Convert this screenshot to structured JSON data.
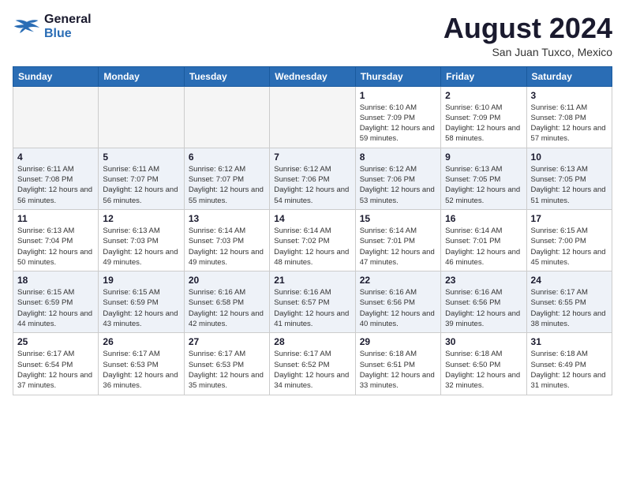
{
  "header": {
    "logo_line1": "General",
    "logo_line2": "Blue",
    "month_year": "August 2024",
    "location": "San Juan Tuxco, Mexico"
  },
  "weekdays": [
    "Sunday",
    "Monday",
    "Tuesday",
    "Wednesday",
    "Thursday",
    "Friday",
    "Saturday"
  ],
  "weeks": [
    [
      {
        "day": "",
        "empty": true
      },
      {
        "day": "",
        "empty": true
      },
      {
        "day": "",
        "empty": true
      },
      {
        "day": "",
        "empty": true
      },
      {
        "day": "1",
        "sunrise": "6:10 AM",
        "sunset": "7:09 PM",
        "daylight": "12 hours and 59 minutes."
      },
      {
        "day": "2",
        "sunrise": "6:10 AM",
        "sunset": "7:09 PM",
        "daylight": "12 hours and 58 minutes."
      },
      {
        "day": "3",
        "sunrise": "6:11 AM",
        "sunset": "7:08 PM",
        "daylight": "12 hours and 57 minutes."
      }
    ],
    [
      {
        "day": "4",
        "sunrise": "6:11 AM",
        "sunset": "7:08 PM",
        "daylight": "12 hours and 56 minutes."
      },
      {
        "day": "5",
        "sunrise": "6:11 AM",
        "sunset": "7:07 PM",
        "daylight": "12 hours and 56 minutes."
      },
      {
        "day": "6",
        "sunrise": "6:12 AM",
        "sunset": "7:07 PM",
        "daylight": "12 hours and 55 minutes."
      },
      {
        "day": "7",
        "sunrise": "6:12 AM",
        "sunset": "7:06 PM",
        "daylight": "12 hours and 54 minutes."
      },
      {
        "day": "8",
        "sunrise": "6:12 AM",
        "sunset": "7:06 PM",
        "daylight": "12 hours and 53 minutes."
      },
      {
        "day": "9",
        "sunrise": "6:13 AM",
        "sunset": "7:05 PM",
        "daylight": "12 hours and 52 minutes."
      },
      {
        "day": "10",
        "sunrise": "6:13 AM",
        "sunset": "7:05 PM",
        "daylight": "12 hours and 51 minutes."
      }
    ],
    [
      {
        "day": "11",
        "sunrise": "6:13 AM",
        "sunset": "7:04 PM",
        "daylight": "12 hours and 50 minutes."
      },
      {
        "day": "12",
        "sunrise": "6:13 AM",
        "sunset": "7:03 PM",
        "daylight": "12 hours and 49 minutes."
      },
      {
        "day": "13",
        "sunrise": "6:14 AM",
        "sunset": "7:03 PM",
        "daylight": "12 hours and 49 minutes."
      },
      {
        "day": "14",
        "sunrise": "6:14 AM",
        "sunset": "7:02 PM",
        "daylight": "12 hours and 48 minutes."
      },
      {
        "day": "15",
        "sunrise": "6:14 AM",
        "sunset": "7:01 PM",
        "daylight": "12 hours and 47 minutes."
      },
      {
        "day": "16",
        "sunrise": "6:14 AM",
        "sunset": "7:01 PM",
        "daylight": "12 hours and 46 minutes."
      },
      {
        "day": "17",
        "sunrise": "6:15 AM",
        "sunset": "7:00 PM",
        "daylight": "12 hours and 45 minutes."
      }
    ],
    [
      {
        "day": "18",
        "sunrise": "6:15 AM",
        "sunset": "6:59 PM",
        "daylight": "12 hours and 44 minutes."
      },
      {
        "day": "19",
        "sunrise": "6:15 AM",
        "sunset": "6:59 PM",
        "daylight": "12 hours and 43 minutes."
      },
      {
        "day": "20",
        "sunrise": "6:16 AM",
        "sunset": "6:58 PM",
        "daylight": "12 hours and 42 minutes."
      },
      {
        "day": "21",
        "sunrise": "6:16 AM",
        "sunset": "6:57 PM",
        "daylight": "12 hours and 41 minutes."
      },
      {
        "day": "22",
        "sunrise": "6:16 AM",
        "sunset": "6:56 PM",
        "daylight": "12 hours and 40 minutes."
      },
      {
        "day": "23",
        "sunrise": "6:16 AM",
        "sunset": "6:56 PM",
        "daylight": "12 hours and 39 minutes."
      },
      {
        "day": "24",
        "sunrise": "6:17 AM",
        "sunset": "6:55 PM",
        "daylight": "12 hours and 38 minutes."
      }
    ],
    [
      {
        "day": "25",
        "sunrise": "6:17 AM",
        "sunset": "6:54 PM",
        "daylight": "12 hours and 37 minutes."
      },
      {
        "day": "26",
        "sunrise": "6:17 AM",
        "sunset": "6:53 PM",
        "daylight": "12 hours and 36 minutes."
      },
      {
        "day": "27",
        "sunrise": "6:17 AM",
        "sunset": "6:53 PM",
        "daylight": "12 hours and 35 minutes."
      },
      {
        "day": "28",
        "sunrise": "6:17 AM",
        "sunset": "6:52 PM",
        "daylight": "12 hours and 34 minutes."
      },
      {
        "day": "29",
        "sunrise": "6:18 AM",
        "sunset": "6:51 PM",
        "daylight": "12 hours and 33 minutes."
      },
      {
        "day": "30",
        "sunrise": "6:18 AM",
        "sunset": "6:50 PM",
        "daylight": "12 hours and 32 minutes."
      },
      {
        "day": "31",
        "sunrise": "6:18 AM",
        "sunset": "6:49 PM",
        "daylight": "12 hours and 31 minutes."
      }
    ]
  ],
  "labels": {
    "sunrise": "Sunrise:",
    "sunset": "Sunset:",
    "daylight": "Daylight:"
  }
}
